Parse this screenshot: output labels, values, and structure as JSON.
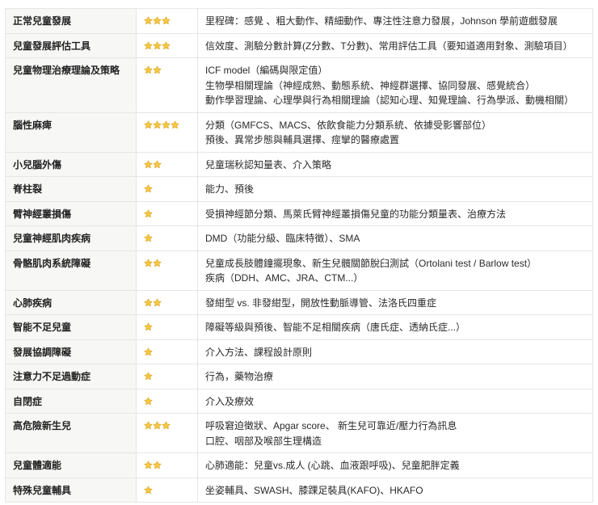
{
  "colors": {
    "star_fill": "#f7c843",
    "star_stroke": "#d9a21b",
    "topic_bg": "#f7f7f6",
    "border": "#e6e6e6"
  },
  "rows": [
    {
      "topic": "正常兒童發展",
      "stars": 3,
      "lines": [
        "里程碑：感覺 、粗大動作、精細動作、專注性注意力發展，Johnson 學前遊戲發展"
      ]
    },
    {
      "topic": "兒童發展評估工具",
      "stars": 3,
      "lines": [
        "信效度、測驗分數計算(Z分數、T分數)、常用評估工具（要知道適用對象、測驗項目）"
      ]
    },
    {
      "topic": "兒童物理治療理論及策略",
      "stars": 2,
      "lines": [
        "ICF model（編碼與限定值）",
        "生物學相關理論（神經成熟、動態系統、神經群選擇、協同發展、感覺統合）",
        "動作學習理論、心理學與行為相關理論（認知心理、知覺理論、行為學派、動機相關）"
      ]
    },
    {
      "topic": "腦性麻痺",
      "stars": 4,
      "lines": [
        "分類（GMFCS、MACS、依飲食能力分類系統、依據受影響部位）",
        "預後、異常步態與輔具選擇、痙攣的醫療處置"
      ]
    },
    {
      "topic": "小兒腦外傷",
      "stars": 2,
      "lines": [
        "兒童瑞秋認知量表、介入策略"
      ]
    },
    {
      "topic": "脊柱裂",
      "stars": 1,
      "lines": [
        "能力、預後"
      ]
    },
    {
      "topic": "臂神經叢損傷",
      "stars": 1,
      "lines": [
        "受損神經節分類、馬萊氏臂神經叢損傷兒童的功能分類量表、治療方法"
      ]
    },
    {
      "topic": "兒童神經肌肉疾病",
      "stars": 1,
      "lines": [
        "DMD（功能分級、臨床特徵）、SMA"
      ]
    },
    {
      "topic": "骨骼肌肉系統障礙",
      "stars": 2,
      "lines": [
        "兒童成長肢體鐘擺現象、新生兒髖關節脫臼測試（Ortolani test / Barlow test）",
        "疾病（DDH、AMC、JRA、CTM...）"
      ]
    },
    {
      "topic": "心肺疾病",
      "stars": 2,
      "lines": [
        "發紺型 vs. 非發紺型，開放性動脈導管、法洛氏四重症"
      ]
    },
    {
      "topic": "智能不足兒童",
      "stars": 1,
      "lines": [
        "障礙等級與預後、智能不足相關疾病（唐氏症、透納氏症...）"
      ]
    },
    {
      "topic": "發展協調障礙",
      "stars": 1,
      "lines": [
        "介入方法、課程設計原則"
      ]
    },
    {
      "topic": "注意力不足過動症",
      "stars": 1,
      "lines": [
        "行為，藥物治療"
      ]
    },
    {
      "topic": "自閉症",
      "stars": 1,
      "lines": [
        "介入及療效"
      ]
    },
    {
      "topic": "高危險新生兒",
      "stars": 3,
      "lines": [
        "呼吸窘迫徵狀、Apgar score、 新生兒可靠近/壓力行為訊息",
        "口腔、咽部及喉部生理構造"
      ]
    },
    {
      "topic": "兒童體適能",
      "stars": 2,
      "lines": [
        "心肺適能：兒童vs.成人 (心跳、血液跟呼吸)、兒童肥胖定義"
      ]
    },
    {
      "topic": "特殊兒童輔具",
      "stars": 1,
      "lines": [
        "坐姿輔具、SWASH、膝踝足裝具(KAFO)、HKAFO"
      ]
    }
  ]
}
